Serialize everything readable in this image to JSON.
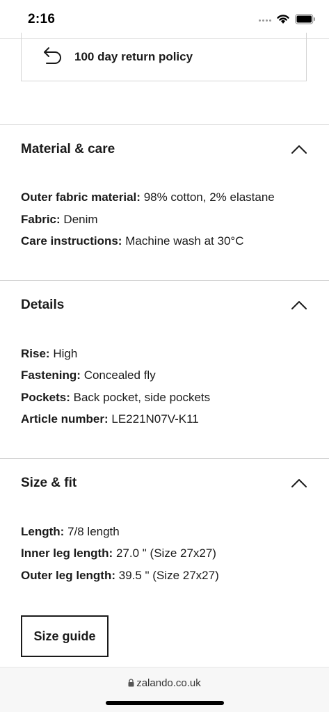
{
  "status_bar": {
    "time": "2:16"
  },
  "return_policy": {
    "label": "100 day return policy"
  },
  "sections": [
    {
      "title": "Material & care",
      "attributes": [
        {
          "key": "Outer fabric material:",
          "value": "98% cotton, 2% elastane"
        },
        {
          "key": "Fabric:",
          "value": "Denim"
        },
        {
          "key": "Care instructions:",
          "value": "Machine wash at 30°C"
        }
      ]
    },
    {
      "title": "Details",
      "attributes": [
        {
          "key": "Rise:",
          "value": "High"
        },
        {
          "key": "Fastening:",
          "value": "Concealed fly"
        },
        {
          "key": "Pockets:",
          "value": "Back pocket, side pockets"
        },
        {
          "key": "Article number:",
          "value": "LE221N07V-K11"
        }
      ]
    },
    {
      "title": "Size & fit",
      "attributes": [
        {
          "key": "Length:",
          "value": "7/8 length"
        },
        {
          "key": "Inner leg length:",
          "value": "27.0 \" (Size 27x27)"
        },
        {
          "key": "Outer leg length:",
          "value": "39.5 \" (Size 27x27)"
        }
      ]
    }
  ],
  "size_guide": {
    "label": "Size guide"
  },
  "browser": {
    "url": "zalando.co.uk"
  }
}
